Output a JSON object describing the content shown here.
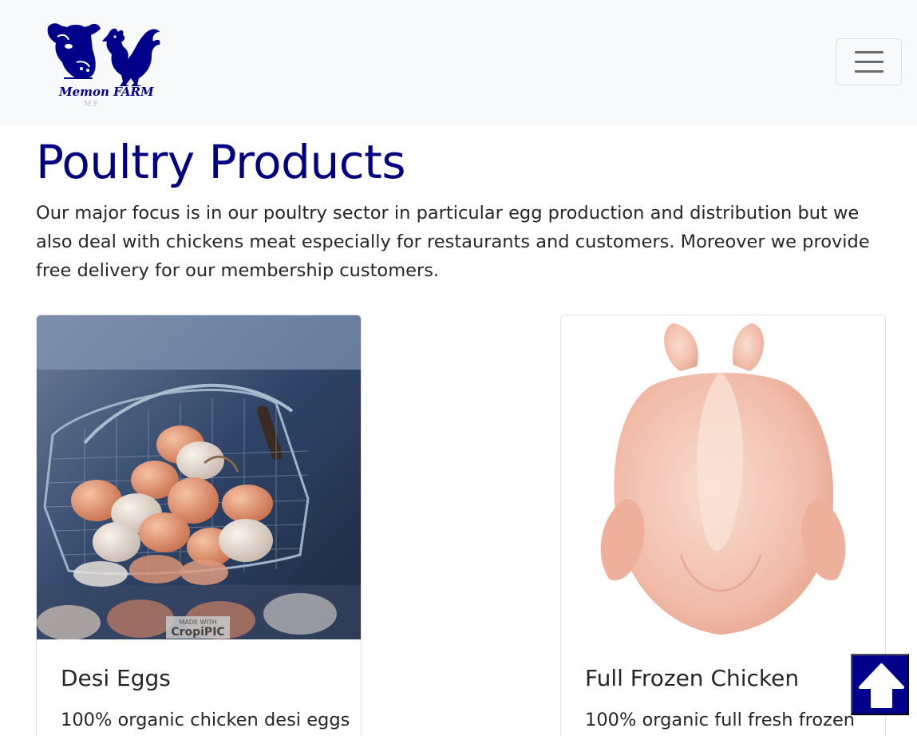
{
  "navbar": {
    "brand_name": "Memon FARM",
    "brand_sub": "M.F"
  },
  "page": {
    "title": "Poultry Products",
    "lead": "Our major focus is in our poultry sector in particular egg production and distribution but we also deal with chickens meat especially for restaurants and customers. Moreover we provide free delivery for our membership customers."
  },
  "products": [
    {
      "title": "Desi Eggs",
      "text": "100% organic chicken desi eggs",
      "image_watermark_top": "MADE WITH",
      "image_watermark": "CropiPIC"
    },
    {
      "title": "Full Frozen Chicken",
      "text": "100% organic full fresh frozen"
    }
  ],
  "icons": {
    "logo": "cow-and-rooster-logo",
    "toggler": "hamburger-icon",
    "scroll_top": "arrow-up-icon"
  },
  "colors": {
    "brand": "#000080",
    "navbar_bg": "#f8f9fa",
    "scroll_top_bg": "#00008b"
  }
}
